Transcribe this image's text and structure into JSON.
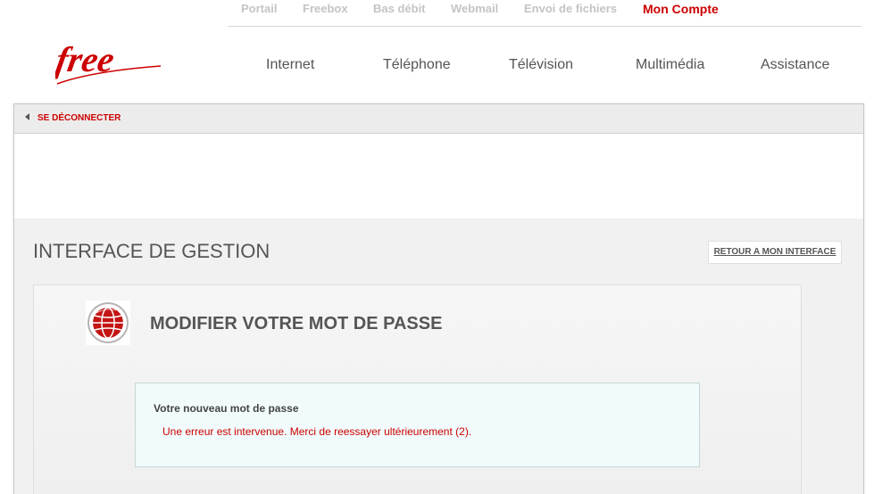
{
  "top_nav": {
    "items": [
      "Portail",
      "Freebox",
      "Bas débit",
      "Webmail",
      "Envoi de fichiers",
      "Mon Compte"
    ],
    "active_index": 5
  },
  "logo": {
    "text": "free"
  },
  "main_nav": {
    "items": [
      "Internet",
      "Téléphone",
      "Télévision",
      "Multimédia",
      "Assistance"
    ]
  },
  "subbar": {
    "logout_label": "SE DÉCONNECTER",
    "logout_icon": "left-triangle-icon"
  },
  "management": {
    "title": "INTERFACE DE GESTION",
    "back_label": "RETOUR A MON INTERFACE"
  },
  "panel": {
    "icon": "globe-icon",
    "title": "MODIFIER VOTRE MOT DE PASSE",
    "field_label": "Votre nouveau mot de passe",
    "error_message": "Une erreur est intervenue. Merci de reessayer ultérieurement (2)."
  },
  "colors": {
    "brand_red": "#cc0000",
    "nav_grey": "#c4c4c4",
    "text_grey": "#555555",
    "message_bg": "#f1fbfb"
  }
}
